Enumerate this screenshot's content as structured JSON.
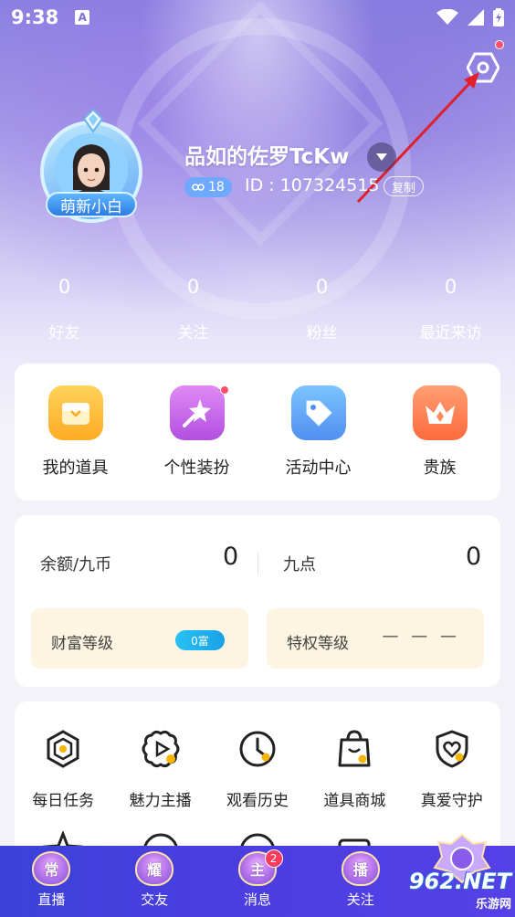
{
  "status_bar": {
    "time": "9:38",
    "notification_glyph": "A"
  },
  "profile": {
    "username": "品如的佐罗TcKw",
    "level": "18",
    "id_text": "ID : 107324515",
    "copy_label": "复制",
    "badge_title": "萌新小白"
  },
  "stats": [
    {
      "value": "0",
      "label": "好友"
    },
    {
      "value": "0",
      "label": "关注"
    },
    {
      "value": "0",
      "label": "粉丝"
    },
    {
      "value": "0",
      "label": "最近来访"
    }
  ],
  "shortcuts": [
    {
      "label": "我的道具",
      "icon": "box-icon",
      "color_from": "#ffd35a",
      "color_to": "#ffab25"
    },
    {
      "label": "个性装扮",
      "icon": "magic-wand-icon",
      "color_from": "#e08af5",
      "color_to": "#b14fe0",
      "has_dot": true
    },
    {
      "label": "活动中心",
      "icon": "tag-icon",
      "color_from": "#7cc4ff",
      "color_to": "#4f8ff0"
    },
    {
      "label": "贵族",
      "icon": "crown-icon",
      "color_from": "#ff9f73",
      "color_to": "#ff6a3d"
    }
  ],
  "balance": {
    "left_label": "余额/九币",
    "left_value": "0",
    "right_label": "九点",
    "right_value": "0"
  },
  "tiers": {
    "wealth_label": "财富等级",
    "wealth_badge": "0富",
    "privilege_label": "特权等级",
    "privilege_value": "— — —"
  },
  "menu": [
    {
      "label": "每日任务",
      "icon": "daily-task-icon"
    },
    {
      "label": "魅力主播",
      "icon": "charm-anchor-icon"
    },
    {
      "label": "观看历史",
      "icon": "clock-icon"
    },
    {
      "label": "道具商城",
      "icon": "shopping-bag-icon"
    },
    {
      "label": "真爱守护",
      "icon": "heart-shield-icon"
    }
  ],
  "tabs": [
    {
      "label": "直播",
      "emblem": "常"
    },
    {
      "label": "交友",
      "emblem": "耀"
    },
    {
      "label": "消息",
      "emblem": "主",
      "badge": "2"
    },
    {
      "label": "关注",
      "emblem": "播"
    },
    {
      "label": "",
      "emblem": ""
    }
  ],
  "watermark": {
    "big": "962.NET",
    "small": "乐游网"
  },
  "colors": {
    "accent": "#7a6fd6",
    "tabbar": "#4a3ee0",
    "alert": "#ff4f6b",
    "tier_bg": "#fdf5e1"
  }
}
